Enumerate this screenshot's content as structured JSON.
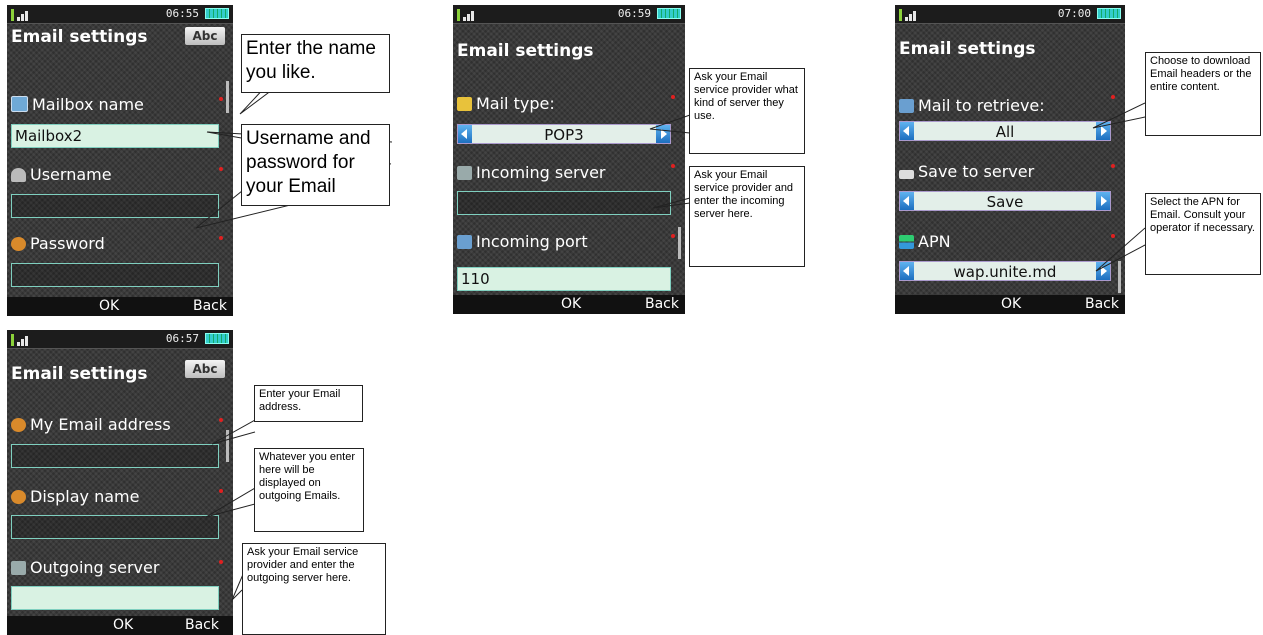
{
  "screens": [
    {
      "time": "06:55",
      "title": "Email settings",
      "input_mode": "Abc",
      "fields": [
        {
          "label": "Mailbox name",
          "value": "Mailbox2",
          "icon": "mailbox-icon"
        },
        {
          "label": "Username",
          "value": "",
          "icon": "user-icon"
        },
        {
          "label": "Password",
          "value": "",
          "icon": "key-icon"
        }
      ],
      "softkeys": {
        "left": "OK",
        "right": "Back"
      }
    },
    {
      "time": "06:59",
      "title": "Email settings",
      "fields": [
        {
          "label": "Mail type:",
          "value": "POP3",
          "icon": "mail-type-icon"
        },
        {
          "label": "Incoming server",
          "value": "",
          "icon": "server-icon"
        },
        {
          "label": "Incoming port",
          "value": "110",
          "icon": "port-icon"
        }
      ],
      "softkeys": {
        "left": "OK",
        "right": "Back"
      }
    },
    {
      "time": "07:00",
      "title": "Email settings",
      "fields": [
        {
          "label": "Mail to retrieve:",
          "value": "All",
          "icon": "retrieve-icon"
        },
        {
          "label": "Save to server",
          "value": "Save",
          "icon": "save-icon"
        },
        {
          "label": "APN",
          "value": "wap.unite.md",
          "icon": "apn-icon"
        }
      ],
      "softkeys": {
        "left": "OK",
        "right": "Back"
      }
    },
    {
      "time": "06:57",
      "title": "Email settings",
      "input_mode": "Abc",
      "fields": [
        {
          "label": "My Email address",
          "value": "",
          "icon": "at-icon"
        },
        {
          "label": "Display name",
          "value": "",
          "icon": "at-icon"
        },
        {
          "label": "Outgoing server",
          "value": "",
          "icon": "server-icon"
        }
      ],
      "softkeys": {
        "left": "OK",
        "right": "Back"
      }
    }
  ],
  "callouts": {
    "mailbox_name": "Enter the name you like.",
    "username_password": "Username and password for your Email",
    "mail_type": "Ask your Email service provider what kind of server they use.",
    "incoming_server": "Ask your Email service provider and enter the incoming server here.",
    "mail_to_retrieve": "Choose to download Email headers or the entire content.",
    "apn": "Select the APN for Email. Consult your operator if necessary.",
    "email_address": "Enter your Email address.",
    "display_name": "Whatever you enter here will be displayed on outgoing Emails.",
    "outgoing_server": "Ask your Email service provider and enter the outgoing server here."
  },
  "colors": {
    "required_marker": "#e02020",
    "selector_arrow": "#1d6fbf",
    "field_border": "#7fcfbf"
  }
}
